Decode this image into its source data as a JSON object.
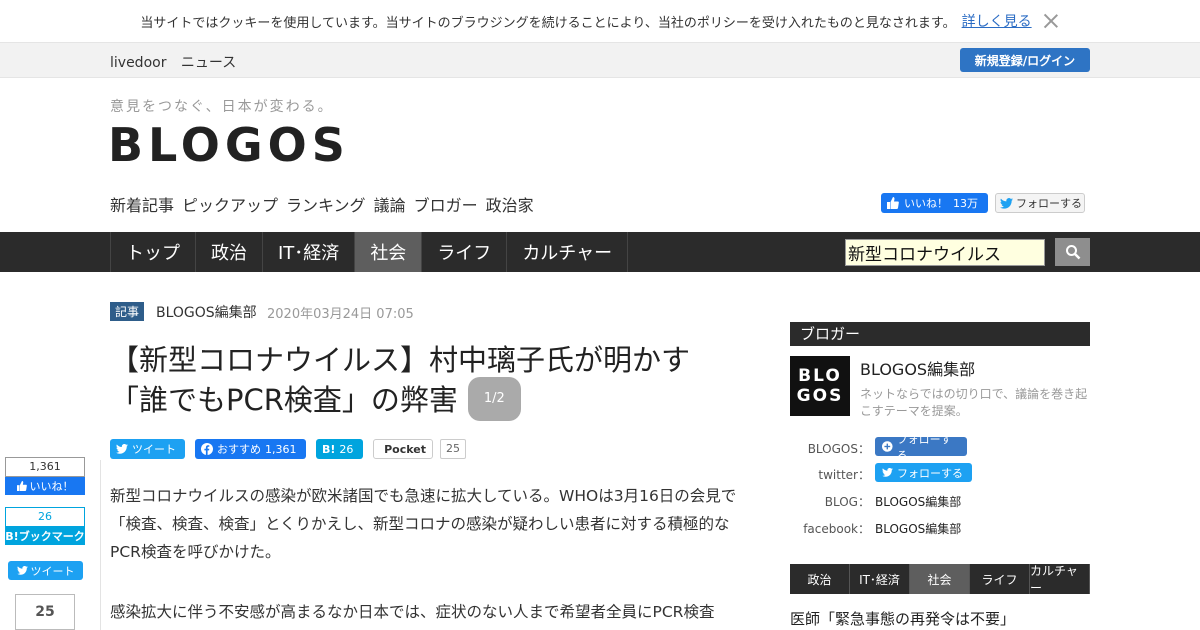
{
  "cookie": {
    "message": "当サイトではクッキーを使用しています。当サイトのブラウジングを続けることにより、当社のポリシーを受け入れたものと見なされます。",
    "more_link": "詳しく見る"
  },
  "topbar": {
    "brand1": "livedoor",
    "brand2": "ニュース",
    "login": "新規登録/ログイン"
  },
  "header": {
    "tagline": "意見をつなぐ、日本が変わる。",
    "logo": "BLOGOS",
    "subnav": [
      "新着記事",
      "ピックアップ",
      "ランキング",
      "議論",
      "ブロガー",
      "政治家"
    ],
    "fb_like": "いいね！",
    "fb_like_count": "13万",
    "tw_follow": "フォローする"
  },
  "mainnav": {
    "items": [
      "トップ",
      "政治",
      "IT･経済",
      "社会",
      "ライフ",
      "カルチャー"
    ],
    "active_index": 3,
    "search_value": "新型コロナウイルス"
  },
  "article": {
    "tag": "記事",
    "author": "BLOGOS編集部",
    "date": "2020年03月24日 07:05",
    "title_line1": "【新型コロナウイルス】村中璃子氏が明かす",
    "title_line2": "「誰でもPCR検査」の弊害",
    "page_badge": "1/2",
    "share": {
      "tweet": "ツイート",
      "fb": "おすすめ",
      "fb_count": "1,361",
      "hb": "B!",
      "hb_count": "26",
      "pocket": "Pocket",
      "pocket_count": "25"
    },
    "para1": "新型コロナウイルスの感染が欧米諸国でも急速に拡大している。WHOは3月16日の会見で「検査、検査、検査」とくりかえし、新型コロナの感染が疑わしい患者に対する積極的なPCR検査を呼びかけた。",
    "para2": "感染拡大に伴う不安感が高まるなか日本では、症状のない人まで希望者全員にPCR検査"
  },
  "left_share": {
    "fb_count": "1,361",
    "fb_label": "いいね！",
    "hb_count": "26",
    "hb_label": "B!ブックマーク",
    "tw_label": "ツイート",
    "pocket_count": "25"
  },
  "sidebar": {
    "header": "ブロガー",
    "avatar_line1": "BLO",
    "avatar_line2": "GOS",
    "name": "BLOGOS編集部",
    "desc": "ネットならではの切り口で、議論を巻き起こすテーマを提案。",
    "rows": {
      "blogos_label": "BLOGOS：",
      "blogos_btn": "フォローする",
      "twitter_label": "twitter：",
      "twitter_btn": "フォローする",
      "blog_label": "BLOG：",
      "blog_val": "BLOGOS編集部",
      "facebook_label": "facebook：",
      "facebook_val": "BLOGOS編集部"
    },
    "cattabs": [
      "政治",
      "IT･経済",
      "社会",
      "ライフ",
      "カルチャー"
    ],
    "cattabs_active": 2,
    "article": "医師「緊急事態の再発令は不要」"
  }
}
